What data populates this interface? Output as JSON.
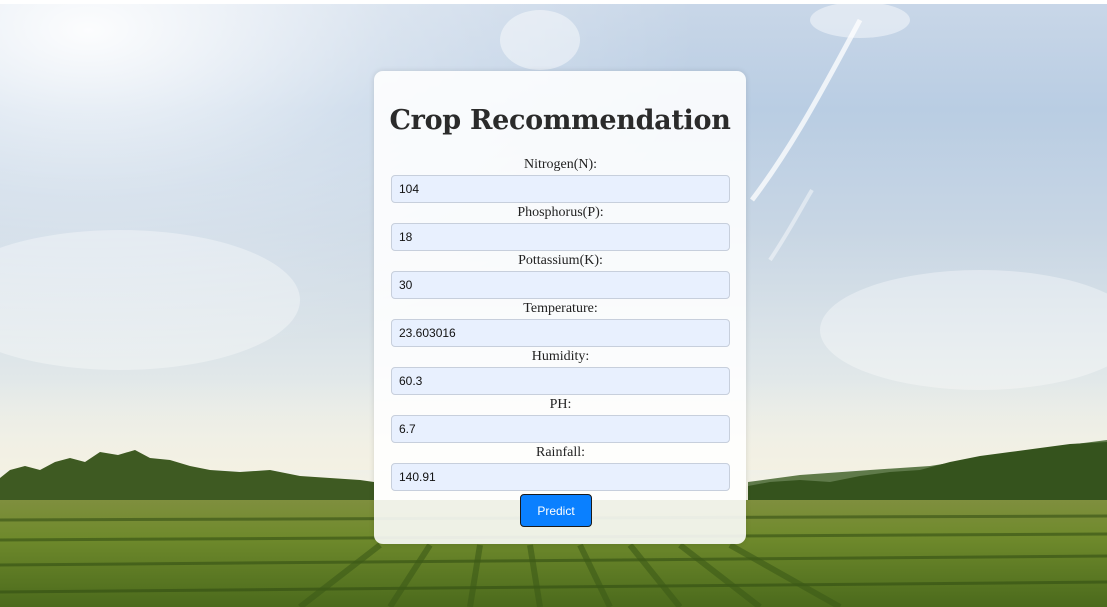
{
  "page": {
    "title": "Crop Recommendation"
  },
  "form": {
    "fields": [
      {
        "label": "Nitrogen(N):",
        "value": "104"
      },
      {
        "label": "Phosphorus(P):",
        "value": "18"
      },
      {
        "label": "Pottassium(K):",
        "value": "30"
      },
      {
        "label": "Temperature:",
        "value": "23.603016"
      },
      {
        "label": "Humidity:",
        "value": "60.3"
      },
      {
        "label": "PH:",
        "value": "6.7"
      },
      {
        "label": "Rainfall:",
        "value": "140.91"
      }
    ],
    "submit_label": "Predict"
  },
  "colors": {
    "button": "#0a80ff",
    "input_bg": "#e8f0fe",
    "card_bg": "#ffffff"
  }
}
